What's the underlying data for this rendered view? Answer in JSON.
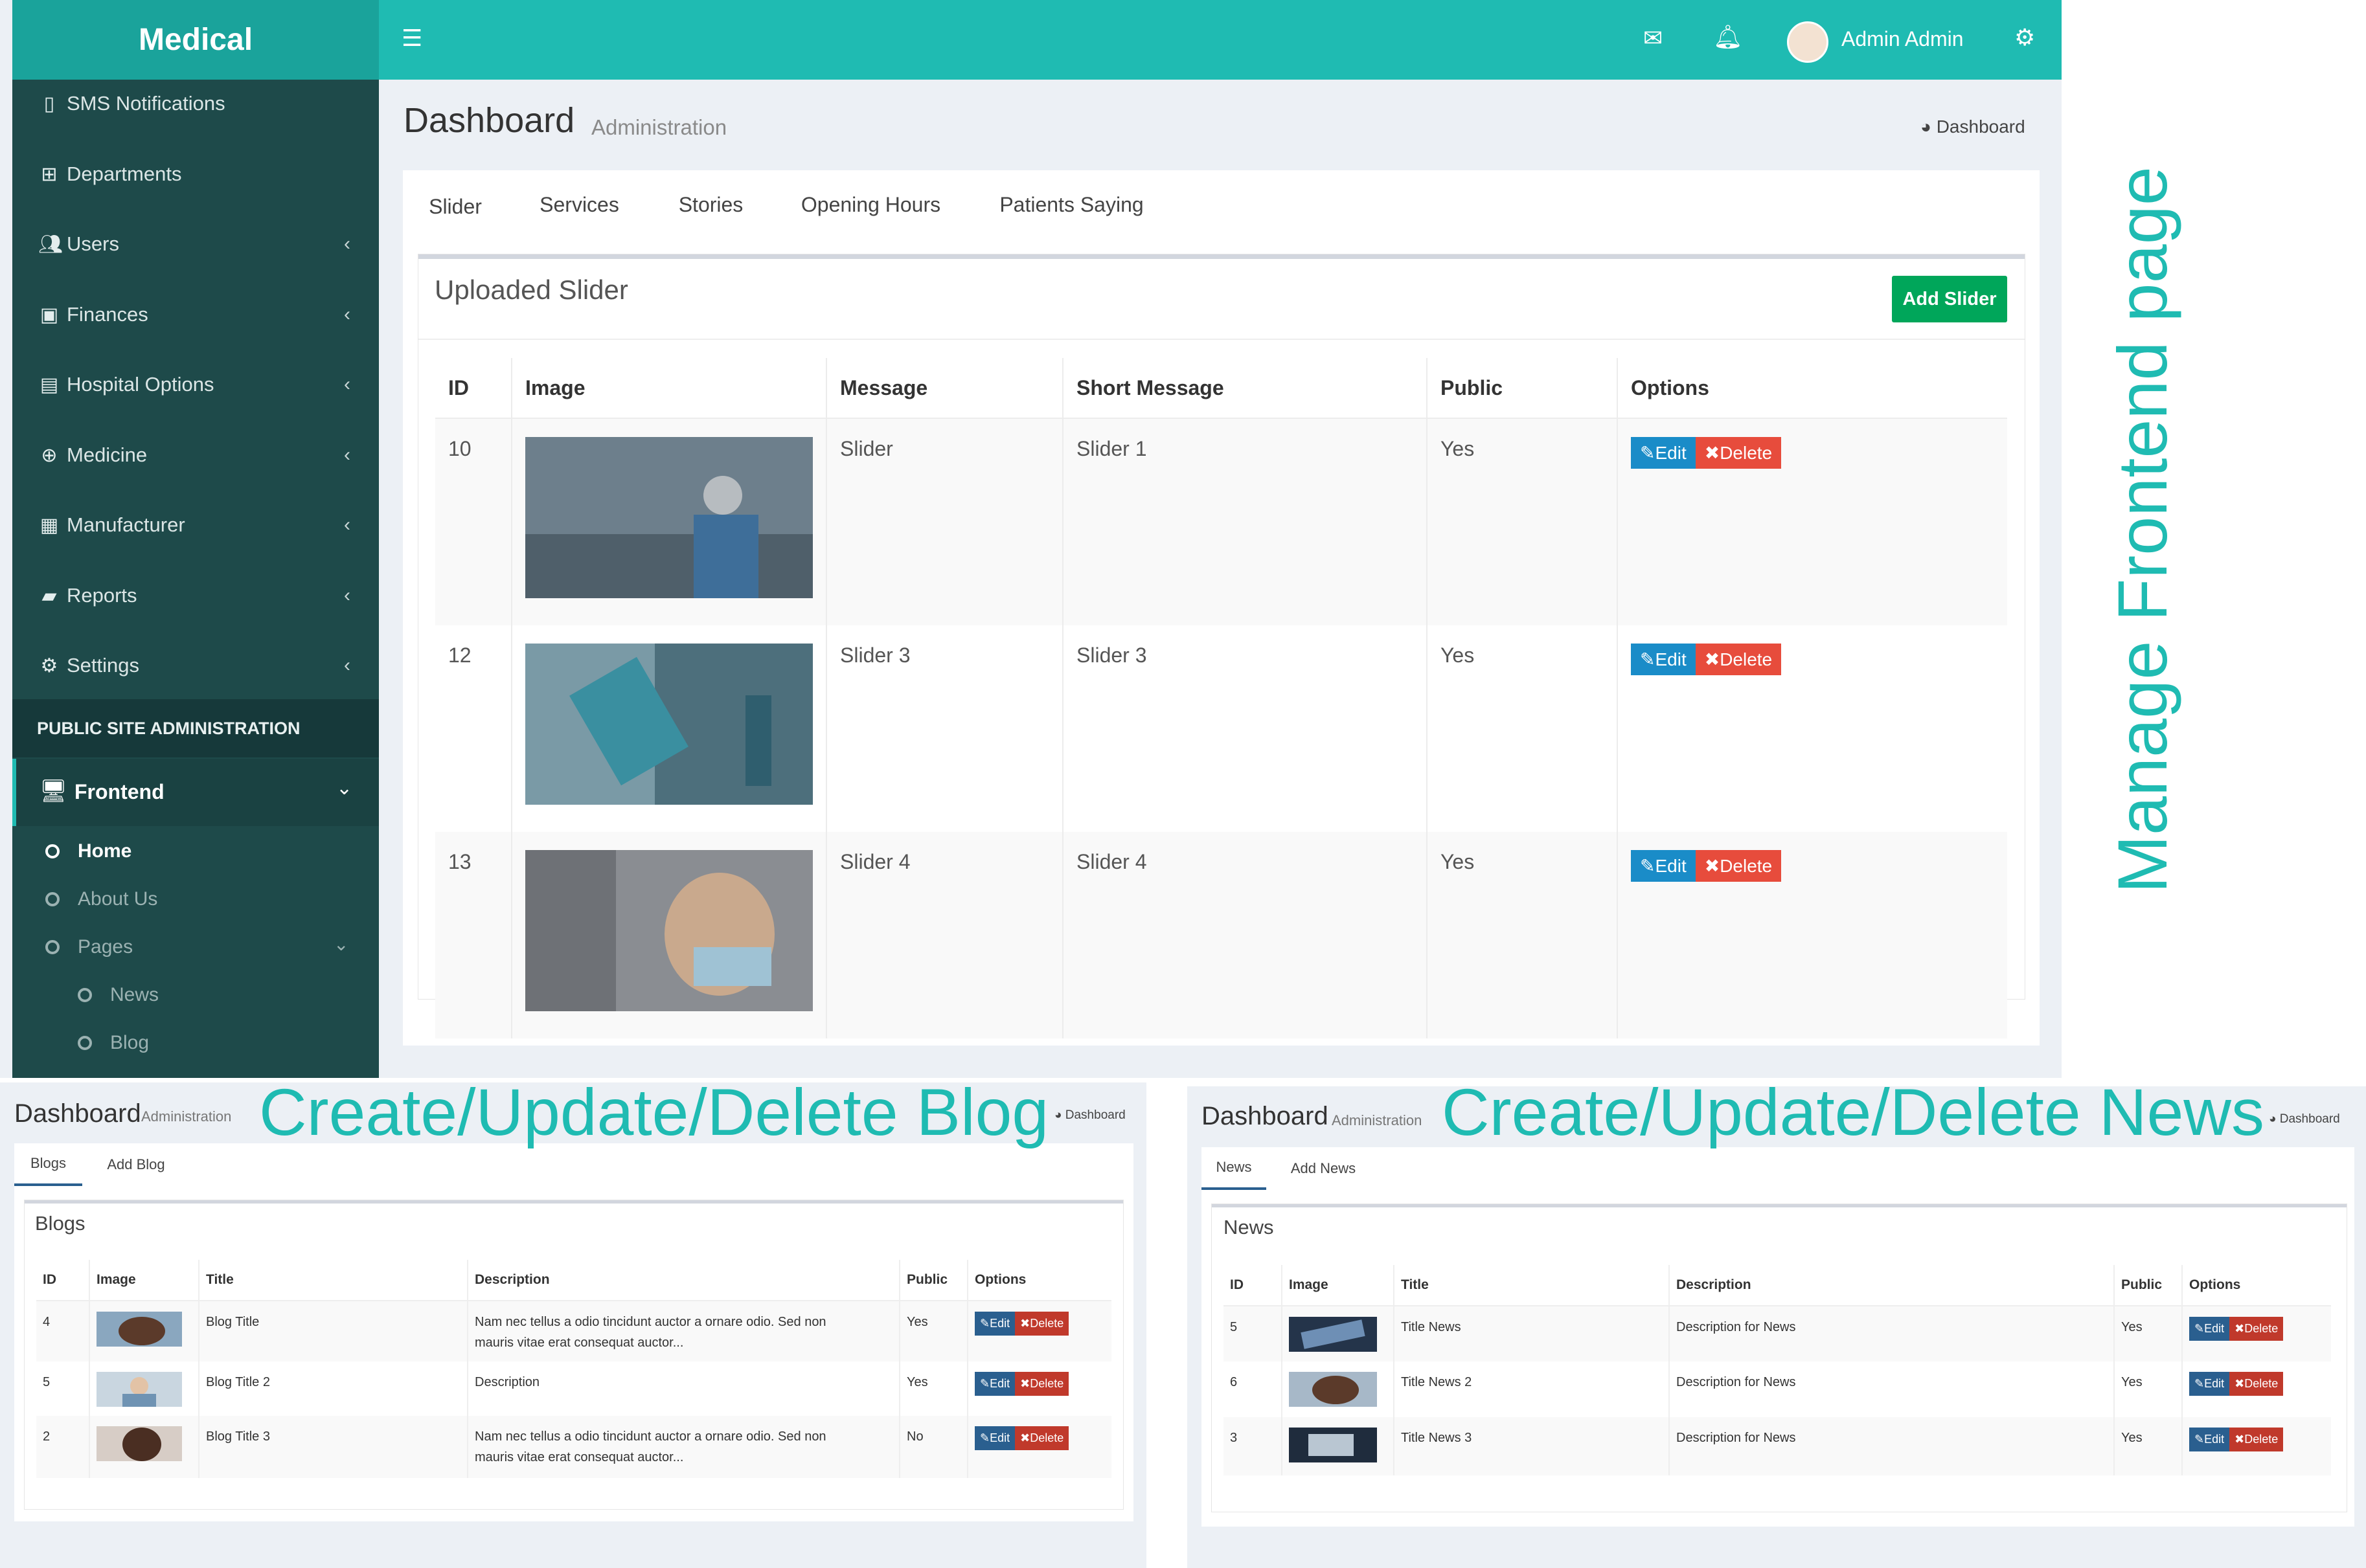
{
  "app": {
    "brand": "Medical"
  },
  "topbar": {
    "menu_icon": "hamburger-icon",
    "mail_icon": "envelope-icon",
    "bell_icon": "bell-icon",
    "user_name": "Admin Admin",
    "settings_icon": "gears-icon",
    "bar_color": "#1fbbb2"
  },
  "sidebar": {
    "items": [
      {
        "label": "SMS Notifications",
        "icon": "mobile-icon"
      },
      {
        "label": "Departments",
        "icon": "sitemap-icon"
      },
      {
        "label": "Users",
        "icon": "users-icon"
      },
      {
        "label": "Finances",
        "icon": "money-icon"
      },
      {
        "label": "Hospital Options",
        "icon": "clipboard-icon"
      },
      {
        "label": "Medicine",
        "icon": "medkit-icon"
      },
      {
        "label": "Manufacturer",
        "icon": "table-icon"
      },
      {
        "label": "Reports",
        "icon": "book-icon"
      },
      {
        "label": "Settings",
        "icon": "gears-icon"
      }
    ],
    "section_header": "PUBLIC SITE ADMINISTRATION",
    "frontend": "Frontend",
    "sub_items": [
      "Home",
      "About Us",
      "Pages"
    ],
    "pages_children": [
      "News",
      "Blog"
    ]
  },
  "content": {
    "title": "Dashboard",
    "subtitle": "Administration",
    "breadcrumb": "Dashboard",
    "tabs": [
      "Slider",
      "Services",
      "Stories",
      "Opening Hours",
      "Patients Saying"
    ],
    "box_title": "Uploaded Slider",
    "add_button": "Add Slider",
    "columns": [
      "ID",
      "Image",
      "Message",
      "Short Message",
      "Public",
      "Options"
    ],
    "rows": [
      {
        "id": "10",
        "message": "Slider",
        "short": "Slider 1",
        "public": "Yes"
      },
      {
        "id": "12",
        "message": "Slider 3",
        "short": "Slider 3",
        "public": "Yes"
      },
      {
        "id": "13",
        "message": "Slider 4",
        "short": "Slider 4",
        "public": "Yes"
      }
    ],
    "edit_label": "Edit",
    "delete_label": "Delete"
  },
  "captions": {
    "right": "Manage Frontend page",
    "blog": "Create/Update/Delete Blog",
    "news": "Create/Update/Delete News"
  },
  "blog": {
    "title": "Dashboard",
    "subtitle": "Administration",
    "breadcrumb": "Dashboard",
    "tabs": [
      "Blogs",
      "Add Blog"
    ],
    "box_title": "Blogs",
    "columns": [
      "ID",
      "Image",
      "Title",
      "Description",
      "Public",
      "Options"
    ],
    "rows": [
      {
        "id": "4",
        "title": "Blog Title",
        "desc": "Nam nec tellus a odio tincidunt auctor a ornare odio. Sed non mauris vitae erat consequat auctor...",
        "public": "Yes"
      },
      {
        "id": "5",
        "title": "Blog Title 2",
        "desc": "Description",
        "public": "Yes"
      },
      {
        "id": "2",
        "title": "Blog Title 3",
        "desc": "Nam nec tellus a odio tincidunt auctor a ornare odio. Sed non mauris vitae erat consequat auctor...",
        "public": "No"
      }
    ],
    "edit_label": "Edit",
    "delete_label": "Delete"
  },
  "news": {
    "title": "Dashboard",
    "subtitle": "Administration",
    "breadcrumb": "Dashboard",
    "tabs": [
      "News",
      "Add News"
    ],
    "box_title": "News",
    "columns": [
      "ID",
      "Image",
      "Title",
      "Description",
      "Public",
      "Options"
    ],
    "rows": [
      {
        "id": "5",
        "title": "Title News",
        "desc": "Description for News",
        "public": "Yes"
      },
      {
        "id": "6",
        "title": "Title News 2",
        "desc": "Description for News",
        "public": "Yes"
      },
      {
        "id": "3",
        "title": "Title News 3",
        "desc": "Description for News",
        "public": "Yes"
      }
    ],
    "edit_label": "Edit",
    "delete_label": "Delete"
  }
}
